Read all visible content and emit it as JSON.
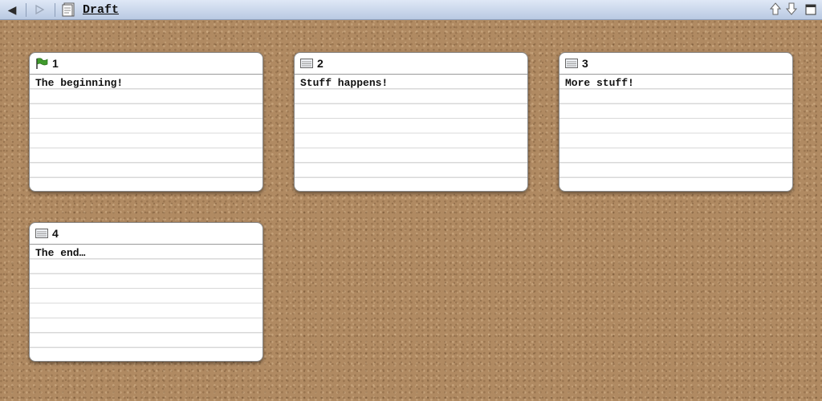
{
  "toolbar": {
    "document_title": "Draft",
    "back_icon": "back-arrow-icon",
    "forward_icon": "forward-arrow-icon",
    "document_icon": "document-icon",
    "up_icon": "up-arrow-icon",
    "down_icon": "down-arrow-icon",
    "window_icon": "window-icon"
  },
  "colors": {
    "toolbar_top": "#dfe8f6",
    "toolbar_bottom": "#b9c9e2",
    "cork": "#b08a62",
    "flag_green": "#3f9a2c"
  },
  "cards": [
    {
      "number": "1",
      "text": "The beginning!",
      "icon": "green-flag-icon"
    },
    {
      "number": "2",
      "text": "Stuff happens!",
      "icon": "index-card-icon"
    },
    {
      "number": "3",
      "text": "More stuff!",
      "icon": "index-card-icon"
    },
    {
      "number": "4",
      "text": "The end…",
      "icon": "index-card-icon"
    }
  ]
}
